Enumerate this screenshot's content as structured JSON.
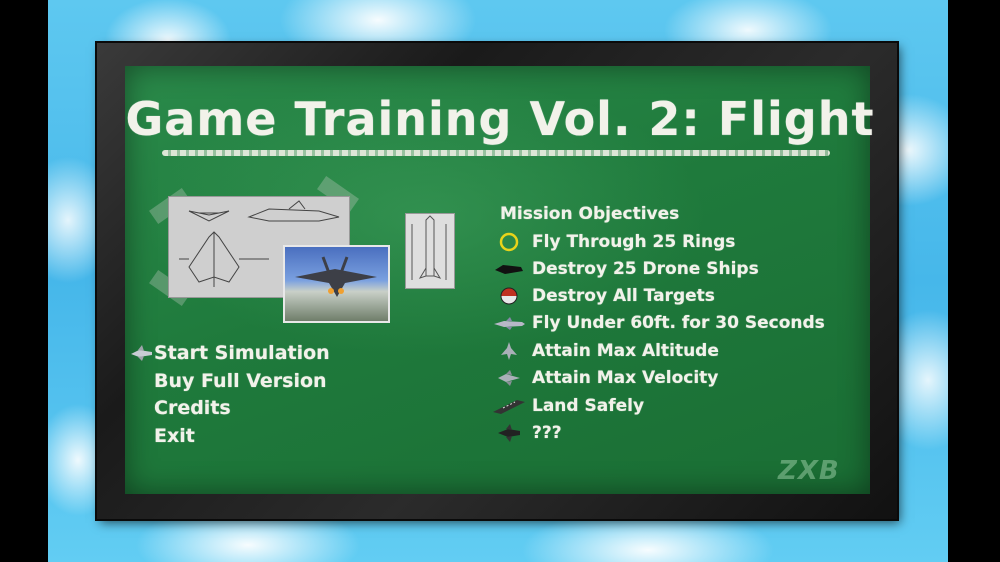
{
  "title": "Game Training Vol. 2: Flight",
  "menu": {
    "items": [
      {
        "label": "Start Simulation",
        "selected": true
      },
      {
        "label": "Buy Full Version",
        "selected": false
      },
      {
        "label": "Credits",
        "selected": false
      },
      {
        "label": "Exit",
        "selected": false
      }
    ]
  },
  "objectives": {
    "header": "Mission Objectives",
    "items": [
      {
        "label": "Fly Through 25 Rings",
        "icon": "ring-icon"
      },
      {
        "label": "Destroy 25 Drone Ships",
        "icon": "drone-ship-icon"
      },
      {
        "label": "Destroy All Targets",
        "icon": "target-ball-icon"
      },
      {
        "label": "Fly Under 60ft. for 30 Seconds",
        "icon": "low-jet-icon"
      },
      {
        "label": "Attain Max Altitude",
        "icon": "altitude-jet-icon"
      },
      {
        "label": "Attain Max Velocity",
        "icon": "velocity-jet-icon"
      },
      {
        "label": "Land Safely",
        "icon": "runway-icon"
      },
      {
        "label": "???",
        "icon": "unknown-jet-icon"
      }
    ]
  },
  "logo": "ZXB",
  "colors": {
    "chalkboard": "#1f7a3c",
    "chalk": "#f2f2ea",
    "ring": "#e8d31a",
    "sky": "#46b7ea"
  }
}
